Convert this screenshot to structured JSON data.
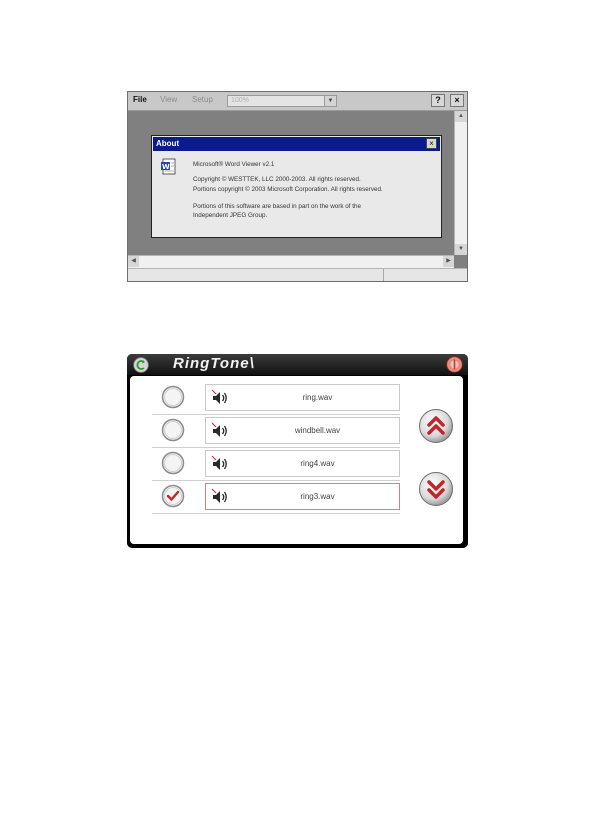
{
  "word_viewer": {
    "menu": {
      "file": "File",
      "view": "View",
      "setup": "Setup"
    },
    "zoom_value": "100%",
    "help_label": "?",
    "close_label": "×",
    "about": {
      "title": "About",
      "close_label": "×",
      "product": "Microsoft® Word Viewer v2.1",
      "copyright1": "Copyright © WESTTEK, LLC 2000-2003.  All rights reserved.",
      "copyright2": "Portions copyright © 2003 Microsoft Corporation.  All rights reserved.",
      "jpeg1": "Portions of this software are based in part on the work of the",
      "jpeg2": "Independent JPEG Group."
    }
  },
  "ringtone": {
    "title": "RingTone\\",
    "items": [
      {
        "file": "ring.wav",
        "selected": false
      },
      {
        "file": "windbell.wav",
        "selected": false
      },
      {
        "file": "ring4.wav",
        "selected": false
      },
      {
        "file": "ring3.wav",
        "selected": true
      }
    ],
    "accent_color": "#c0262c"
  }
}
